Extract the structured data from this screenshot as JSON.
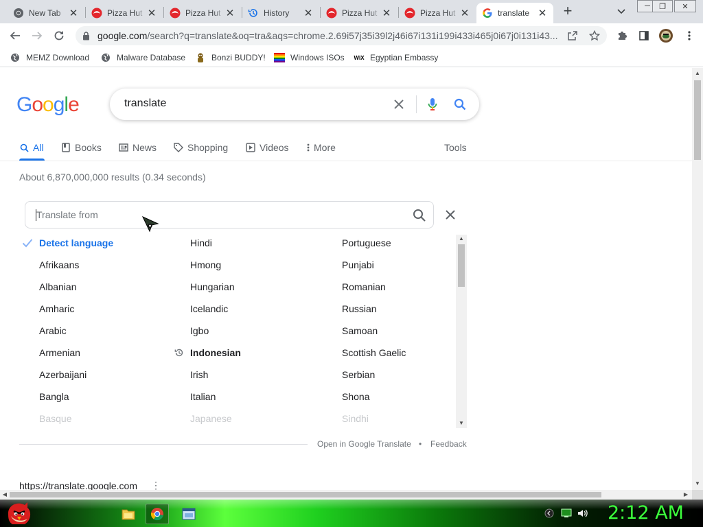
{
  "browser": {
    "tabs": [
      {
        "title": "New Tab",
        "icon": "chrome-icon",
        "active": false
      },
      {
        "title": "Pizza Hut",
        "icon": "pizza-hut-icon",
        "active": false
      },
      {
        "title": "Pizza Hut",
        "icon": "pizza-hut-icon",
        "active": false
      },
      {
        "title": "History",
        "icon": "history-icon",
        "active": false
      },
      {
        "title": "Pizza Hut",
        "icon": "pizza-hut-icon",
        "active": false
      },
      {
        "title": "Pizza Hut",
        "icon": "pizza-hut-icon",
        "active": false
      },
      {
        "title": "translate",
        "icon": "google-icon",
        "active": true
      }
    ],
    "close_glyph": "✕",
    "new_tab_glyph": "+",
    "window_controls": [
      "─",
      "❐",
      "✕"
    ],
    "url_host": "google.com",
    "url_path": "/search?q=translate&oq=tra&aqs=chrome.2.69i57j35i39l2j46i67i131i199i433i465j0i67j0i131i43...",
    "bookmarks": [
      {
        "label": "MEMZ Download",
        "icon": "globe-icon"
      },
      {
        "label": "Malware Database",
        "icon": "globe-icon"
      },
      {
        "label": "Bonzi BUDDY!",
        "icon": "bonzi-icon"
      },
      {
        "label": "Windows ISOs",
        "icon": "rainbow-flag-icon"
      },
      {
        "label": "Egyptian Embassy",
        "icon": "wix-icon",
        "icon_text": "WIX"
      }
    ]
  },
  "google": {
    "logo_letters": [
      {
        "ch": "G",
        "color": "#4285f4"
      },
      {
        "ch": "o",
        "color": "#ea4335"
      },
      {
        "ch": "o",
        "color": "#fbbc05"
      },
      {
        "ch": "g",
        "color": "#4285f4"
      },
      {
        "ch": "l",
        "color": "#34a853"
      },
      {
        "ch": "e",
        "color": "#ea4335"
      }
    ],
    "query": "translate",
    "nav_tabs": [
      {
        "label": "All",
        "icon": "search-icon",
        "active": true
      },
      {
        "label": "Books",
        "icon": "book-icon",
        "active": false
      },
      {
        "label": "News",
        "icon": "news-icon",
        "active": false
      },
      {
        "label": "Shopping",
        "icon": "tag-icon",
        "active": false
      },
      {
        "label": "Videos",
        "icon": "play-icon",
        "active": false
      },
      {
        "label": "More",
        "icon": "more-vert-icon",
        "active": false
      }
    ],
    "tools_label": "Tools",
    "result_stats": "About 6,870,000,000 results (0.34 seconds)"
  },
  "translate_widget": {
    "placeholder": "Translate from",
    "columns": [
      [
        {
          "name": "Detect language",
          "state": "selected"
        },
        {
          "name": "Afrikaans"
        },
        {
          "name": "Albanian"
        },
        {
          "name": "Amharic"
        },
        {
          "name": "Arabic"
        },
        {
          "name": "Armenian"
        },
        {
          "name": "Azerbaijani"
        },
        {
          "name": "Bangla"
        },
        {
          "name": "Basque",
          "state": "fade"
        }
      ],
      [
        {
          "name": "Hindi"
        },
        {
          "name": "Hmong"
        },
        {
          "name": "Hungarian"
        },
        {
          "name": "Icelandic"
        },
        {
          "name": "Igbo"
        },
        {
          "name": "Indonesian",
          "state": "recent"
        },
        {
          "name": "Irish"
        },
        {
          "name": "Italian"
        },
        {
          "name": "Japanese",
          "state": "fade"
        }
      ],
      [
        {
          "name": "Portuguese"
        },
        {
          "name": "Punjabi"
        },
        {
          "name": "Romanian"
        },
        {
          "name": "Russian"
        },
        {
          "name": "Samoan"
        },
        {
          "name": "Scottish Gaelic"
        },
        {
          "name": "Serbian"
        },
        {
          "name": "Shona"
        },
        {
          "name": "Sindhi",
          "state": "fade"
        }
      ]
    ],
    "open_in_translate": "Open in Google Translate",
    "bullet": "•",
    "feedback": "Feedback"
  },
  "first_result": {
    "url": "https://translate.google.com",
    "menu_glyph": "⋮"
  },
  "taskbar": {
    "clock": "2:12 AM",
    "colors": {
      "clock": "#3cff3c",
      "bar": "#1fd01f"
    }
  },
  "colors": {
    "accent": "#1a73e8",
    "text": "#202124",
    "muted": "#70757a"
  }
}
